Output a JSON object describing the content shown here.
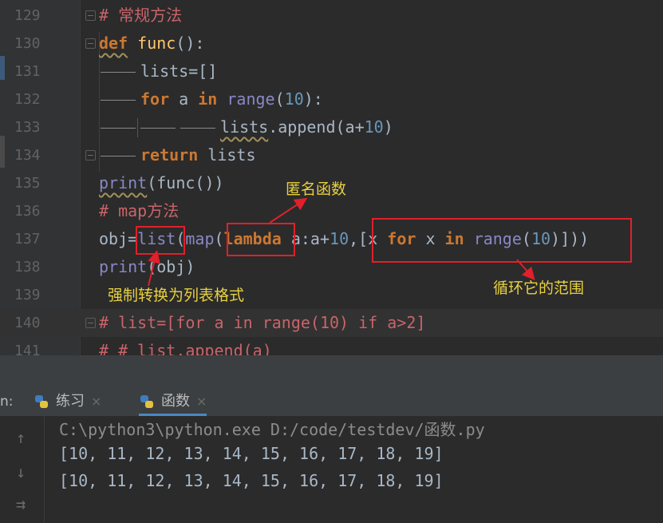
{
  "editor": {
    "lines": [
      {
        "n": "129",
        "code": "# 常规方法"
      },
      {
        "n": "130",
        "code": "def func():"
      },
      {
        "n": "131",
        "code": "lists=[]"
      },
      {
        "n": "132",
        "code": "for a in range(10):"
      },
      {
        "n": "133",
        "code": "lists.append(a+10)"
      },
      {
        "n": "134",
        "code": "return lists"
      },
      {
        "n": "135",
        "code": "print(func())"
      },
      {
        "n": "136",
        "code": "# map方法"
      },
      {
        "n": "137",
        "code": "obj=list(map(lambda a:a+10,[x for x in range(10)]))"
      },
      {
        "n": "138",
        "code": "print(obj)"
      },
      {
        "n": "139",
        "code": ""
      },
      {
        "n": "140",
        "code": "# list=[for a in range(10) if a>2]"
      },
      {
        "n": "141",
        "code": "# # list.append(a)"
      }
    ]
  },
  "annotations": {
    "lambda_note": "匿名函数",
    "list_note": "强制转换为列表格式",
    "range_note": "循环它的范围"
  },
  "run_panel": {
    "label": "n:",
    "tabs": [
      {
        "label": "练习",
        "close": "×"
      },
      {
        "label": "函数",
        "close": "×"
      }
    ],
    "output": [
      "C:\\python3\\python.exe D:/code/testdev/函数.py",
      "[10, 11, 12, 13, 14, 15, 16, 17, 18, 19]",
      "[10, 11, 12, 13, 14, 15, 16, 17, 18, 19]"
    ],
    "icons": [
      "arrow-up-icon",
      "arrow-down-icon",
      "soft-wrap-icon"
    ]
  },
  "colors": {
    "keyword": "#cc7832",
    "function": "#ffc66d",
    "number": "#6897bb",
    "param": "#c670d8",
    "comment": "#c8646a",
    "annotation": "#e7d040",
    "box": "#e0202a"
  }
}
